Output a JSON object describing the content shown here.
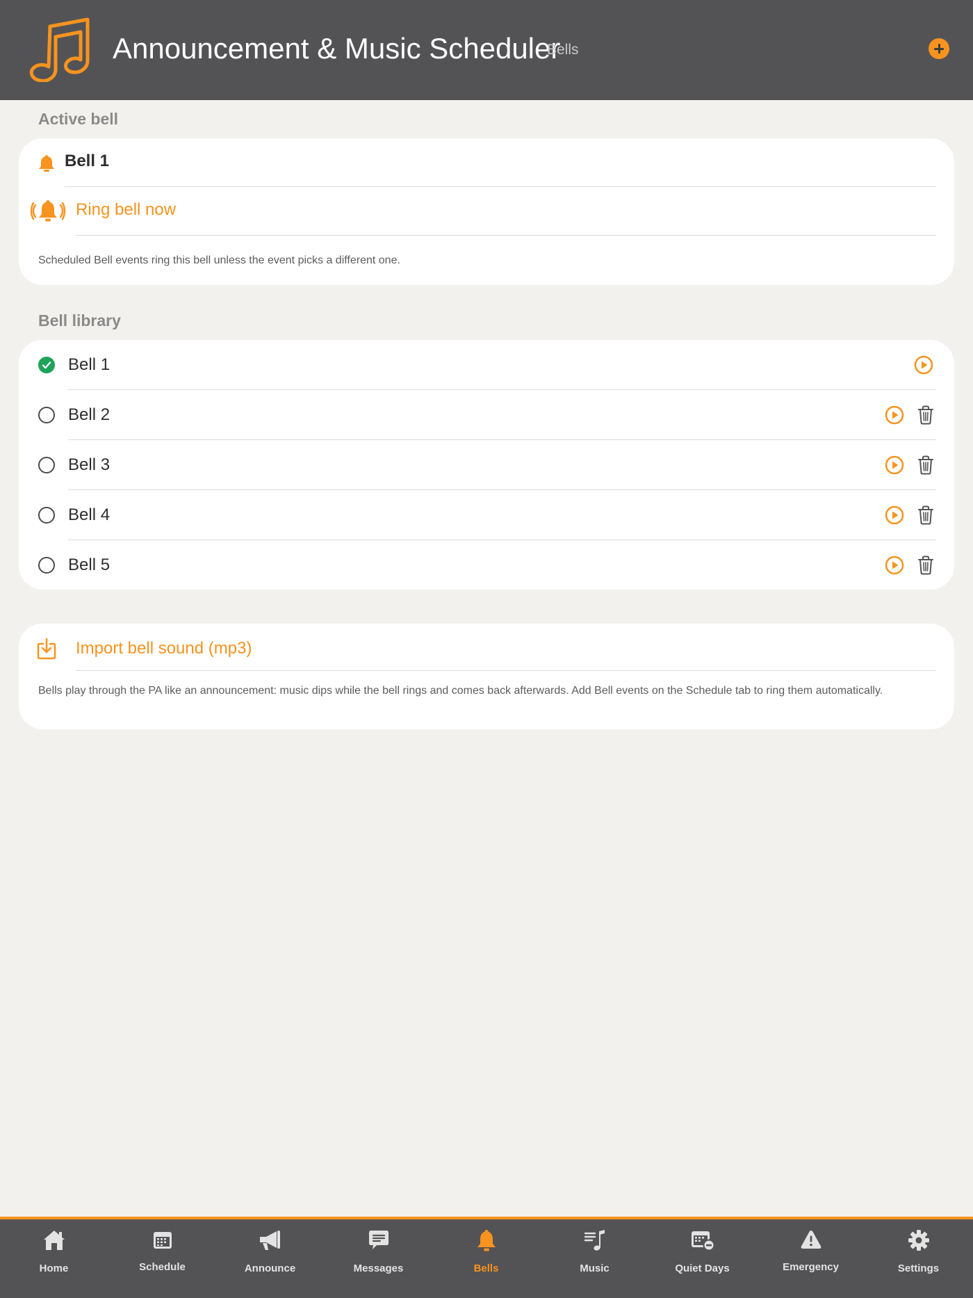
{
  "header": {
    "title": "Announcement & Music Scheduler",
    "subtitle": "Bells"
  },
  "active_bell": {
    "section_label": "Active bell",
    "name": "Bell 1",
    "ring_label": "Ring bell now",
    "note": "Scheduled Bell events ring this bell unless the event picks a different one."
  },
  "library": {
    "section_label": "Bell library",
    "items": [
      {
        "label": "Bell 1",
        "selected": true,
        "deletable": false
      },
      {
        "label": "Bell 2",
        "selected": false,
        "deletable": true
      },
      {
        "label": "Bell 3",
        "selected": false,
        "deletable": true
      },
      {
        "label": "Bell 4",
        "selected": false,
        "deletable": true
      },
      {
        "label": "Bell 5",
        "selected": false,
        "deletable": true
      }
    ]
  },
  "import": {
    "label": "Import bell sound (mp3)",
    "note": "Bells play through the PA like an announcement: music dips while the bell rings and comes back afterwards. Add Bell events on the Schedule tab to ring them automatically."
  },
  "tabs": [
    {
      "label": "Home",
      "icon": "home-icon",
      "active": false
    },
    {
      "label": "Schedule",
      "icon": "calendar-icon",
      "active": false
    },
    {
      "label": "Announce",
      "icon": "megaphone-icon",
      "active": false
    },
    {
      "label": "Messages",
      "icon": "message-icon",
      "active": false
    },
    {
      "label": "Bells",
      "icon": "bell-icon",
      "active": true
    },
    {
      "label": "Music",
      "icon": "music-list-icon",
      "active": false
    },
    {
      "label": "Quiet Days",
      "icon": "calendar-minus-icon",
      "active": false
    },
    {
      "label": "Emergency",
      "icon": "warning-icon",
      "active": false
    },
    {
      "label": "Settings",
      "icon": "gear-icon",
      "active": false
    }
  ],
  "colors": {
    "accent": "#f7931e",
    "header_bg": "#535356",
    "page_bg": "#f2f1ee",
    "selected": "#1fa35a"
  }
}
